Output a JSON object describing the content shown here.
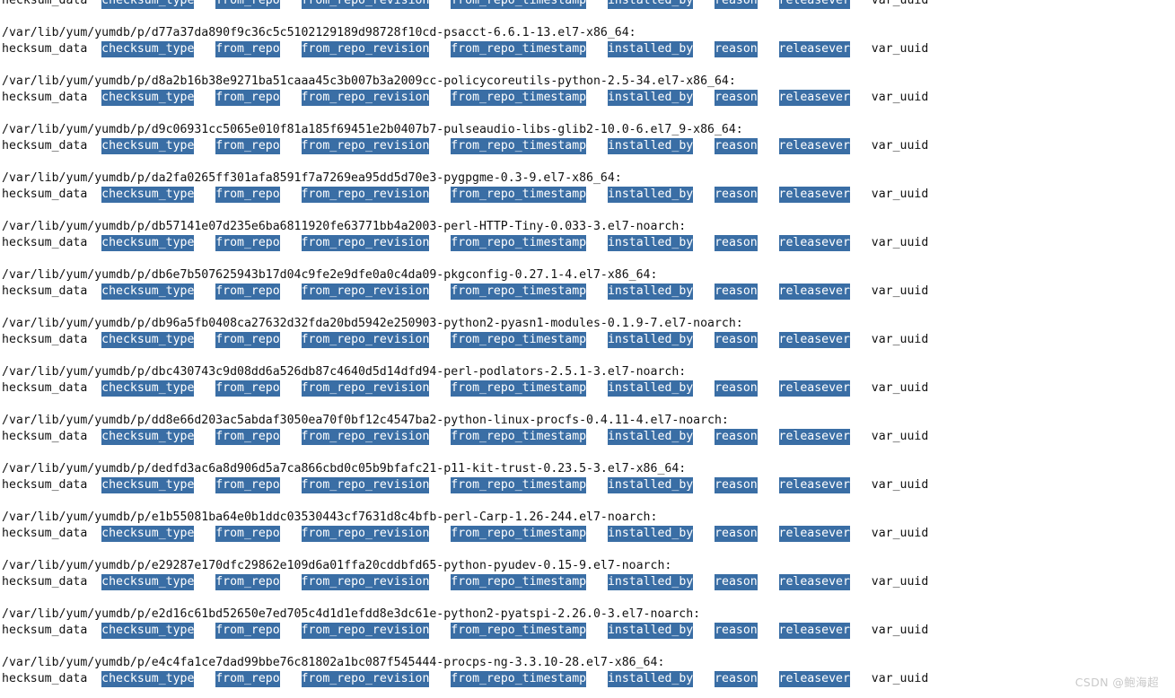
{
  "terminal": {
    "background_color": "#ffffff",
    "text_color": "#111111",
    "highlight_background_color": "#3a6ea5",
    "highlight_text_color": "#ffffff",
    "first_line_clipped": true
  },
  "field_labels": [
    {
      "text": "hecksum_data",
      "highlighted": false,
      "gap_after": "  "
    },
    {
      "text": "checksum_type",
      "highlighted": true,
      "gap_after": "   "
    },
    {
      "text": "from_repo",
      "highlighted": true,
      "gap_after": "   "
    },
    {
      "text": "from_repo_revision",
      "highlighted": true,
      "gap_after": "   "
    },
    {
      "text": "from_repo_timestamp",
      "highlighted": true,
      "gap_after": "   "
    },
    {
      "text": "installed_by",
      "highlighted": true,
      "gap_after": "   "
    },
    {
      "text": "reason",
      "highlighted": true,
      "gap_after": "   "
    },
    {
      "text": "releasever",
      "highlighted": true,
      "gap_after": "   "
    },
    {
      "text": "var_uuid",
      "highlighted": false,
      "gap_after": ""
    }
  ],
  "entries": [
    {
      "path": "",
      "show_path": false
    },
    {
      "path": "/var/lib/yum/yumdb/p/d77a37da890f9c36c5c5102129189d98728f10cd-psacct-6.6.1-13.el7-x86_64:",
      "show_path": true,
      "hash": "d77a37da890f9c36c5c5102129189d98728f10cd",
      "package": "psacct",
      "version": "6.6.1",
      "release": "13.el7",
      "arch": "x86_64"
    },
    {
      "path": "/var/lib/yum/yumdb/p/d8a2b16b38e9271ba51caaa45c3b007b3a2009cc-policycoreutils-python-2.5-34.el7-x86_64:",
      "show_path": true,
      "hash": "d8a2b16b38e9271ba51caaa45c3b007b3a2009cc",
      "package": "policycoreutils-python",
      "version": "2.5",
      "release": "34.el7",
      "arch": "x86_64"
    },
    {
      "path": "/var/lib/yum/yumdb/p/d9c06931cc5065e010f81a185f69451e2b0407b7-pulseaudio-libs-glib2-10.0-6.el7_9-x86_64:",
      "show_path": true,
      "hash": "d9c06931cc5065e010f81a185f69451e2b0407b7",
      "package": "pulseaudio-libs-glib2",
      "version": "10.0",
      "release": "6.el7_9",
      "arch": "x86_64"
    },
    {
      "path": "/var/lib/yum/yumdb/p/da2fa0265ff301afa8591f7a7269ea95dd5d70e3-pygpgme-0.3-9.el7-x86_64:",
      "show_path": true,
      "hash": "da2fa0265ff301afa8591f7a7269ea95dd5d70e3",
      "package": "pygpgme",
      "version": "0.3",
      "release": "9.el7",
      "arch": "x86_64"
    },
    {
      "path": "/var/lib/yum/yumdb/p/db57141e07d235e6ba6811920fe63771bb4a2003-perl-HTTP-Tiny-0.033-3.el7-noarch:",
      "show_path": true,
      "hash": "db57141e07d235e6ba6811920fe63771bb4a2003",
      "package": "perl-HTTP-Tiny",
      "version": "0.033",
      "release": "3.el7",
      "arch": "noarch"
    },
    {
      "path": "/var/lib/yum/yumdb/p/db6e7b507625943b17d04c9fe2e9dfe0a0c4da09-pkgconfig-0.27.1-4.el7-x86_64:",
      "show_path": true,
      "hash": "db6e7b507625943b17d04c9fe2e9dfe0a0c4da09",
      "package": "pkgconfig",
      "version": "0.27.1",
      "release": "4.el7",
      "arch": "x86_64"
    },
    {
      "path": "/var/lib/yum/yumdb/p/db96a5fb0408ca27632d32fda20bd5942e250903-python2-pyasn1-modules-0.1.9-7.el7-noarch:",
      "show_path": true,
      "hash": "db96a5fb0408ca27632d32fda20bd5942e250903",
      "package": "python2-pyasn1-modules",
      "version": "0.1.9",
      "release": "7.el7",
      "arch": "noarch"
    },
    {
      "path": "/var/lib/yum/yumdb/p/dbc430743c9d08dd6a526db87c4640d5d14dfd94-perl-podlators-2.5.1-3.el7-noarch:",
      "show_path": true,
      "hash": "dbc430743c9d08dd6a526db87c4640d5d14dfd94",
      "package": "perl-podlators",
      "version": "2.5.1",
      "release": "3.el7",
      "arch": "noarch"
    },
    {
      "path": "/var/lib/yum/yumdb/p/dd8e66d203ac5abdaf3050ea70f0bf12c4547ba2-python-linux-procfs-0.4.11-4.el7-noarch:",
      "show_path": true,
      "hash": "dd8e66d203ac5abdaf3050ea70f0bf12c4547ba2",
      "package": "python-linux-procfs",
      "version": "0.4.11",
      "release": "4.el7",
      "arch": "noarch"
    },
    {
      "path": "/var/lib/yum/yumdb/p/dedfd3ac6a8d906d5a7ca866cbd0c05b9bfafc21-p11-kit-trust-0.23.5-3.el7-x86_64:",
      "show_path": true,
      "hash": "dedfd3ac6a8d906d5a7ca866cbd0c05b9bfafc21",
      "package": "p11-kit-trust",
      "version": "0.23.5",
      "release": "3.el7",
      "arch": "x86_64"
    },
    {
      "path": "/var/lib/yum/yumdb/p/e1b55081ba64e0b1ddc03530443cf7631d8c4bfb-perl-Carp-1.26-244.el7-noarch:",
      "show_path": true,
      "hash": "e1b55081ba64e0b1ddc03530443cf7631d8c4bfb",
      "package": "perl-Carp",
      "version": "1.26",
      "release": "244.el7",
      "arch": "noarch"
    },
    {
      "path": "/var/lib/yum/yumdb/p/e29287e170dfc29862e109d6a01ffa20cddbfd65-python-pyudev-0.15-9.el7-noarch:",
      "show_path": true,
      "hash": "e29287e170dfc29862e109d6a01ffa20cddbfd65",
      "package": "python-pyudev",
      "version": "0.15",
      "release": "9.el7",
      "arch": "noarch"
    },
    {
      "path": "/var/lib/yum/yumdb/p/e2d16c61bd52650e7ed705c4d1d1efdd8e3dc61e-python2-pyatspi-2.26.0-3.el7-noarch:",
      "show_path": true,
      "hash": "e2d16c61bd52650e7ed705c4d1d1efdd8e3dc61e",
      "package": "python2-pyatspi",
      "version": "2.26.0",
      "release": "3.el7",
      "arch": "noarch"
    },
    {
      "path": "/var/lib/yum/yumdb/p/e4c4fa1ce7dad99bbe76c81802a1bc087f545444-procps-ng-3.3.10-28.el7-x86_64:",
      "show_path": true,
      "hash": "e4c4fa1ce7dad99bbe76c81802a1bc087f545444",
      "package": "procps-ng",
      "version": "3.3.10",
      "release": "28.el7",
      "arch": "x86_64"
    }
  ],
  "watermark": {
    "text": "CSDN @鲍海超"
  }
}
